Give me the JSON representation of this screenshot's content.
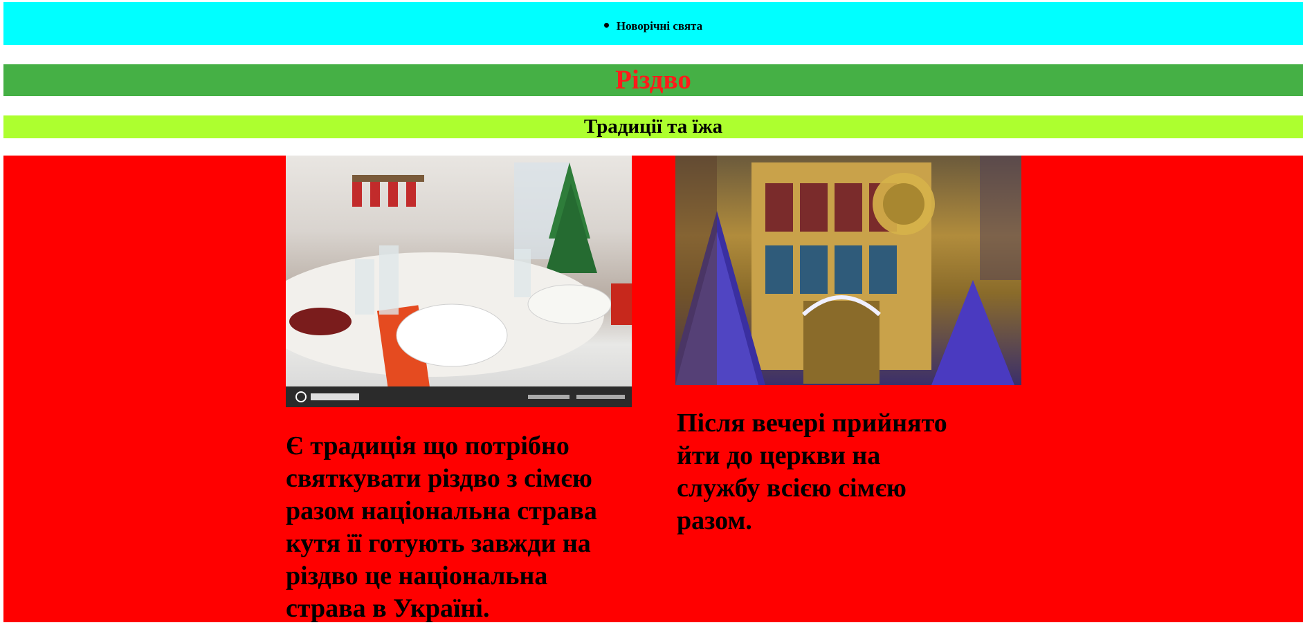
{
  "nav": {
    "items": [
      {
        "label": "Новорічні свята"
      }
    ]
  },
  "header": {
    "title": "Різдво",
    "subtitle": "Традиції та їжа"
  },
  "content": {
    "left": {
      "image_icon": "photo-icon",
      "caption": "Є традиція що потрібно святкувати різдво з сімєю разом національна страва кутя її готують завжди на різдво це національна страва в Україні."
    },
    "right": {
      "image_icon": "photo-icon",
      "caption": "Після вечері прийнято йти до церкви на службу всією сімєю разом."
    }
  },
  "colors": {
    "nav_bg": "#00ffff",
    "title_bg": "#45b045",
    "title_text": "#ff1a1a",
    "subtitle_bg": "#adff2f",
    "content_bg": "#ff0000"
  }
}
